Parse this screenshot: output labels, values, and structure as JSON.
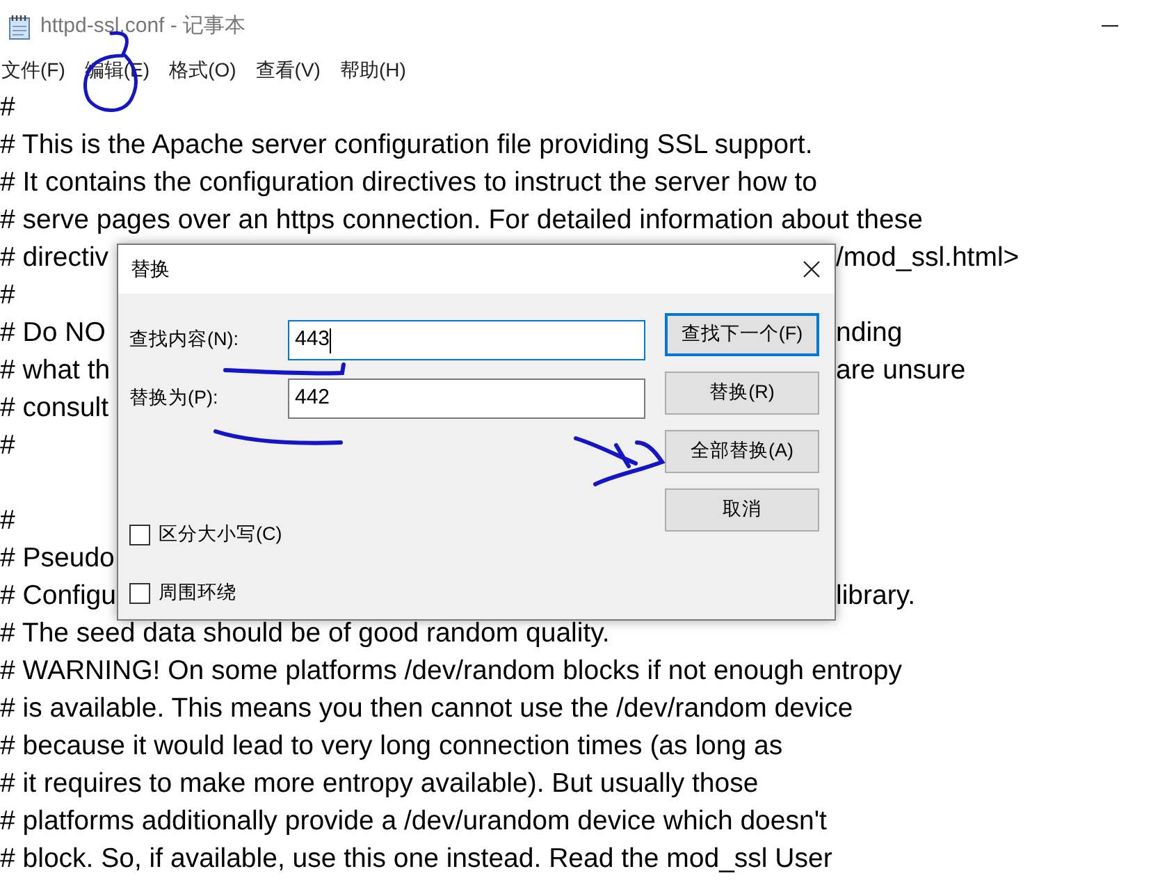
{
  "window": {
    "title": "httpd-ssl.conf - 记事本"
  },
  "menu": [
    {
      "label": "文件(F)"
    },
    {
      "label": "编辑(E)"
    },
    {
      "label": "格式(O)"
    },
    {
      "label": "查看(V)"
    },
    {
      "label": "帮助(H)"
    }
  ],
  "editor": {
    "lines": [
      {
        "text": "#"
      },
      {
        "text": "# This is the Apache server configuration file providing SSL support."
      },
      {
        "text": "# It contains the configuration directives to instruct the server how to"
      },
      {
        "text": "# serve pages over an https connection. For detailed information about these"
      },
      {
        "text": "# directiv",
        "tail": "/mod_ssl.html>"
      },
      {
        "text": "#"
      },
      {
        "text": "# Do NO",
        "tail": "nding"
      },
      {
        "text": "# what th",
        "tail": "are unsure"
      },
      {
        "text": "# consult"
      },
      {
        "text": "#"
      },
      {
        "text": "#",
        "blank_line_before": true
      },
      {
        "text": "# Pseudo"
      },
      {
        "text": "# Configu",
        "tail": "library."
      },
      {
        "text": "# The seed data should be of good random quality."
      },
      {
        "text": "# WARNING! On some platforms /dev/random blocks if not enough entropy"
      },
      {
        "text": "# is available. This means you then cannot use the /dev/random device"
      },
      {
        "text": "# because it would lead to very long connection times (as long as"
      },
      {
        "text": "# it requires to make more entropy available). But usually those"
      },
      {
        "text": "# platforms additionally provide a /dev/urandom device which doesn't"
      },
      {
        "text": "# block. So, if available, use this one instead. Read the mod_ssl User"
      }
    ]
  },
  "dialog": {
    "title": "替换",
    "fields": [
      {
        "label": "查找内容(N):",
        "value": "443",
        "focused": true
      },
      {
        "label": "替换为(P):",
        "value": "442",
        "focused": false
      }
    ],
    "buttons": [
      {
        "label": "查找下一个(F)",
        "default": true
      },
      {
        "label": "替换(R)",
        "default": false
      },
      {
        "label": "全部替换(A)",
        "default": false
      },
      {
        "label": "取消",
        "default": false
      }
    ],
    "checkboxes": [
      {
        "label": "区分大小写(C)",
        "checked": false
      },
      {
        "label": "周围环绕",
        "checked": false
      }
    ]
  }
}
